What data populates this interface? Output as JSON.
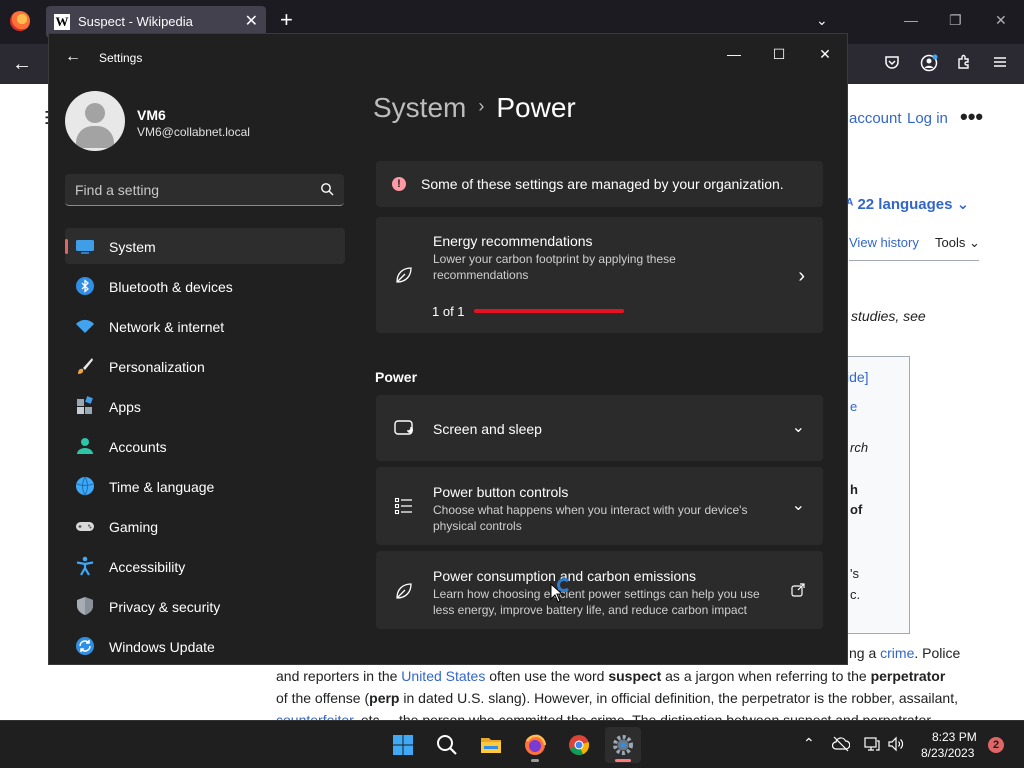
{
  "firefox": {
    "tab_favicon": "W",
    "tab_title": "Suspect - Wikipedia",
    "tab_close": "✕",
    "new_tab": "+",
    "tab_list": "⌄",
    "minimize": "—",
    "maximize": "❐",
    "close": "✕",
    "back": "←"
  },
  "wiki": {
    "menu_glyph": "☰",
    "account": "account",
    "login": "Log in",
    "more": "•••",
    "languages": "ᴬ 22 languages ⌄",
    "history": "View history",
    "tools": "Tools ⌄",
    "studies": "studies, see",
    "hide": "ide]",
    "frag_rch": "rch",
    "frag_h": "h",
    "frag_of": "of",
    "frag_s": "'s",
    "frag_c": "c.",
    "line1_prefix": "ng a ",
    "line1_link": "crime",
    "line1_suffix": ". Police",
    "line2_a": "and reporters in the ",
    "line2_link": "United States",
    "line2_b": " often use the word ",
    "line2_bold1": "suspect",
    "line2_c": " as a jargon when referring to the ",
    "line2_bold2": "perpetrator",
    "line3_a": "of the offense (",
    "line3_bold": "perp",
    "line3_b": " in dated U.S. slang). However, in official definition, the perpetrator is the robber, assailant,",
    "line4_link": "counterfeiter",
    "line4_b": ", etc. – the person who committed the crime. The distinction between suspect and perpetrator"
  },
  "settings": {
    "back": "←",
    "title": "Settings",
    "minimize": "—",
    "maximize": "☐",
    "close": "✕",
    "user": {
      "name": "VM6",
      "email": "VM6@collabnet.local"
    },
    "search_placeholder": "Find a setting",
    "nav": [
      {
        "label": "System",
        "icon": "system-icon",
        "active": true
      },
      {
        "label": "Bluetooth & devices",
        "icon": "bluetooth-icon"
      },
      {
        "label": "Network & internet",
        "icon": "network-icon"
      },
      {
        "label": "Personalization",
        "icon": "personalization-icon"
      },
      {
        "label": "Apps",
        "icon": "apps-icon"
      },
      {
        "label": "Accounts",
        "icon": "accounts-icon"
      },
      {
        "label": "Time & language",
        "icon": "time-language-icon"
      },
      {
        "label": "Gaming",
        "icon": "gaming-icon"
      },
      {
        "label": "Accessibility",
        "icon": "accessibility-icon"
      },
      {
        "label": "Privacy & security",
        "icon": "privacy-icon"
      },
      {
        "label": "Windows Update",
        "icon": "windows-update-icon"
      }
    ],
    "breadcrumb": {
      "parent": "System",
      "separator": "›",
      "current": "Power"
    },
    "org_banner": {
      "icon": "!",
      "text": "Some of these settings are managed by your organization."
    },
    "energy": {
      "title": "Energy recommendations",
      "desc": "Lower your carbon footprint by applying these recommendations",
      "count": "1 of 1",
      "progress": 1.0,
      "chevron": "›"
    },
    "power_heading": "Power",
    "screen_sleep": {
      "title": "Screen and sleep",
      "chevron": "⌄"
    },
    "power_button": {
      "title": "Power button controls",
      "desc": "Choose what happens when you interact with your device's physical controls",
      "chevron": "⌄"
    },
    "consumption": {
      "title": "Power consumption and carbon emissions",
      "desc": "Learn how choosing efficient power settings can help you use less energy, improve battery life, and reduce carbon impact",
      "link_icon": "external-link-icon"
    }
  },
  "taskbar": {
    "apps": [
      "start-icon",
      "search-icon",
      "file-explorer-icon",
      "firefox-icon",
      "chrome-icon",
      "settings-icon"
    ],
    "tray_chevron": "⌃",
    "time": "8:23 PM",
    "date": "8/23/2023",
    "notifications": "2"
  },
  "colors": {
    "accent": "#e06666",
    "energy_bar": "#e81123",
    "link": "#3366cc"
  }
}
